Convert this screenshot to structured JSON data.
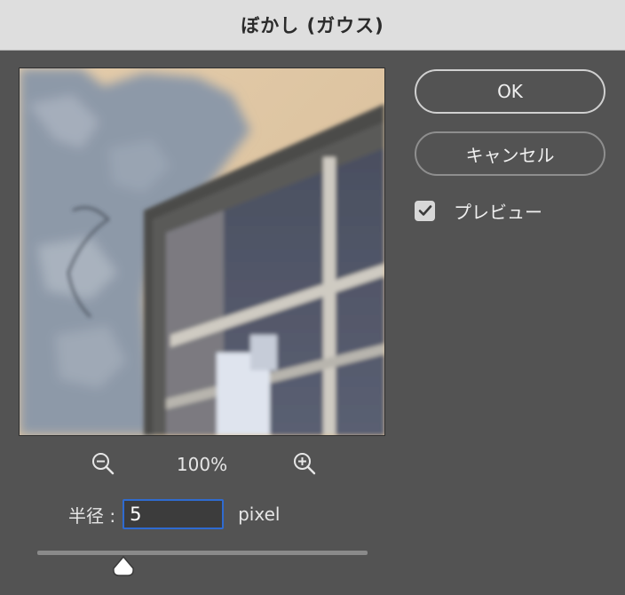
{
  "window": {
    "title": "ぼかし (ガウス)"
  },
  "preview": {
    "zoom_level": "100%"
  },
  "radius": {
    "label": "半径 :",
    "value": "5",
    "unit": "pixel",
    "slider_level": 0.26
  },
  "buttons": {
    "ok_label": "OK",
    "cancel_label": "キャンセル"
  },
  "preview_toggle": {
    "label": "プレビュー",
    "checked": true
  },
  "icons": {
    "zoom_out": "zoom-out-icon",
    "zoom_in": "zoom-in-icon",
    "checkmark": "checkmark-icon",
    "slider_thumb": "slider-thumb-icon"
  },
  "colors": {
    "accent_focus": "#2f6bd0",
    "background": "#535353",
    "titlebar": "#dedede"
  }
}
